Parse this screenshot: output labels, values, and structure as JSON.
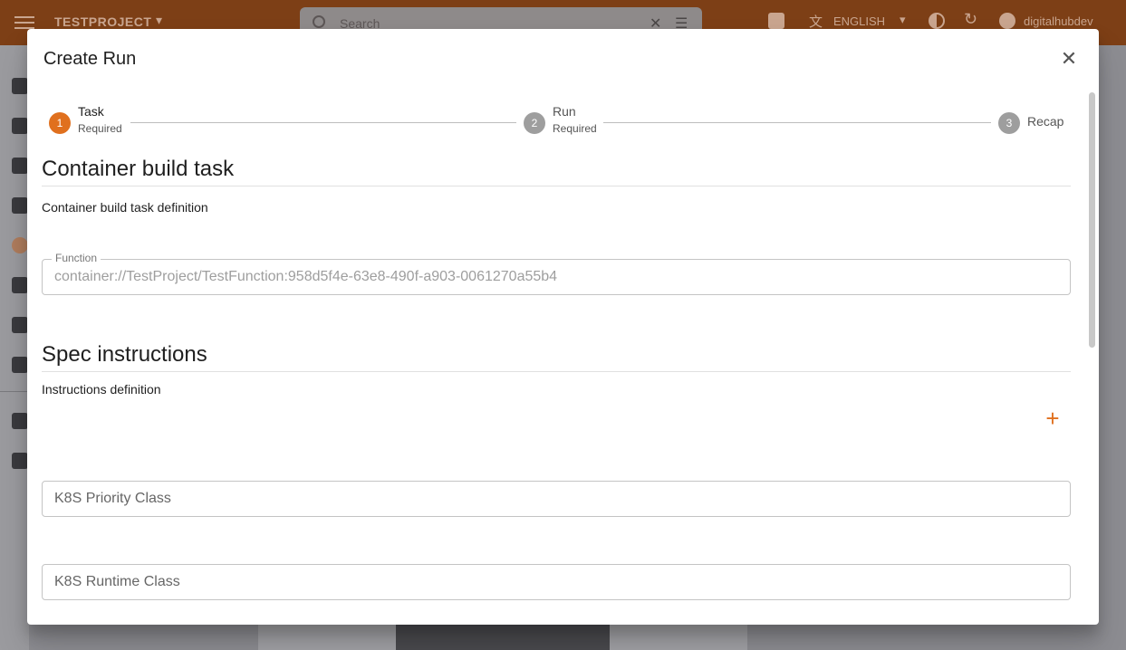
{
  "appbar": {
    "project": "TESTPROJECT",
    "search_placeholder": "Search",
    "language": "ENGLISH",
    "user": "digitalhubdev"
  },
  "modal": {
    "title": "Create Run",
    "steps": [
      {
        "number": "1",
        "label": "Task",
        "sub": "Required",
        "active": true
      },
      {
        "number": "2",
        "label": "Run",
        "sub": "Required",
        "active": false
      },
      {
        "number": "3",
        "label": "Recap",
        "sub": "",
        "active": false
      }
    ],
    "task_section": {
      "title": "Container build task",
      "description": "Container build task definition",
      "function_label": "Function",
      "function_value": "container://TestProject/TestFunction:958d5f4e-63e8-490f-a903-0061270a55b4"
    },
    "spec_section": {
      "title": "Spec instructions",
      "description": "Instructions definition",
      "add_symbol": "+"
    },
    "priority_class_placeholder": "K8S Priority Class",
    "runtime_class_placeholder": "K8S Runtime Class"
  },
  "colors": {
    "accent": "#e0701e",
    "step_inactive": "#9e9e9e"
  },
  "icons": [
    "menu-icon",
    "search-icon",
    "clear-icon",
    "filter-icon",
    "help-icon",
    "translate-icon",
    "theme-icon",
    "refresh-icon",
    "user-icon",
    "close-icon",
    "add-icon"
  ]
}
